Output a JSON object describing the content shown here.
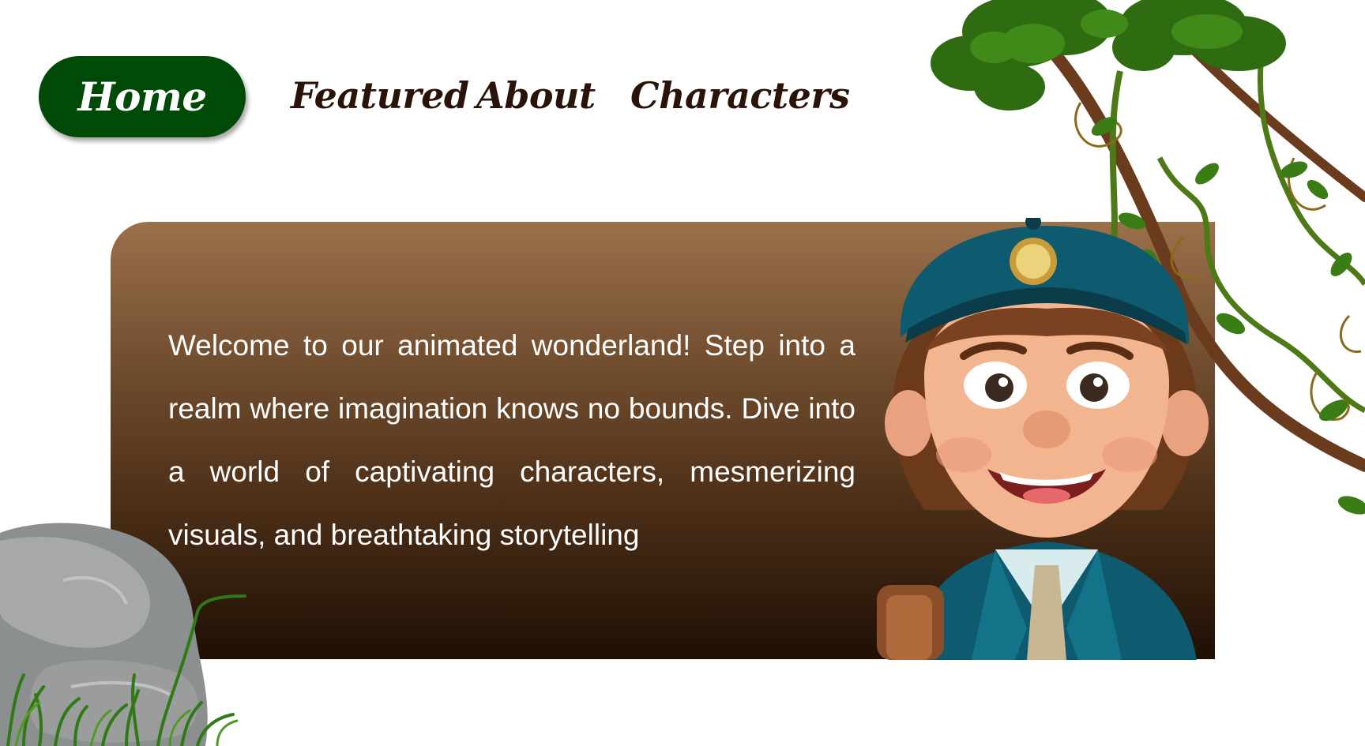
{
  "nav": {
    "items": [
      {
        "label": "Home",
        "active": true
      },
      {
        "label": "Featured",
        "active": false
      },
      {
        "label": "About",
        "active": false
      },
      {
        "label": "Characters",
        "active": false
      }
    ]
  },
  "hero": {
    "text": "Welcome to our animated wonderland! Step into a realm where imagination knows no bounds. Dive into a world of captivating characters, mesmerizing visuals, and breathtaking storytelling"
  },
  "colors": {
    "nav_active_bg": "#004a07",
    "nav_text": "#2a1409",
    "card_top": "#9b704b",
    "card_bottom": "#1f1005",
    "hero_text": "#ffffff"
  },
  "icons": {
    "vine": "jungle-vine-illustration",
    "rock": "rock-with-grass-illustration",
    "character": "cartoon-boy-in-cap-illustration"
  }
}
